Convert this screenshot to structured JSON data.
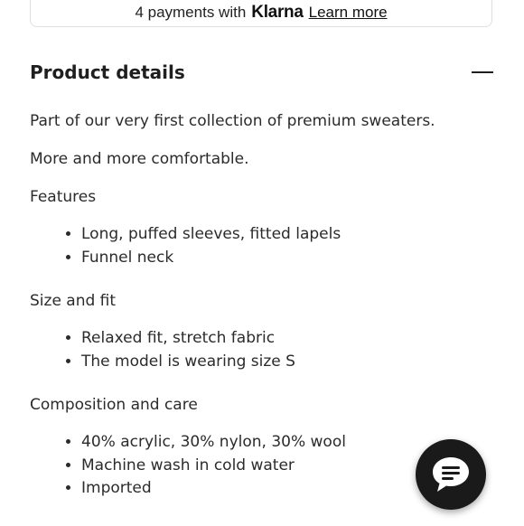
{
  "payments": {
    "prefix": "4 payments with",
    "brand": "Klarna",
    "link": "Learn more"
  },
  "details": {
    "title": "Product details",
    "collapse_icon": "minus-icon",
    "intro": "Part of our very first collection of premium sweaters.",
    "tagline": "More and more comfortable.",
    "sections": [
      {
        "title": "Features",
        "items": [
          "Long, puffed sleeves, fitted lapels",
          "Funnel neck"
        ]
      },
      {
        "title": "Size and fit",
        "items": [
          "Relaxed fit, stretch fabric",
          "The model is wearing size S"
        ]
      },
      {
        "title": "Composition and care",
        "items": [
          "40% acrylic, 30% nylon, 30% wool",
          "Machine wash in cold water",
          "Imported"
        ]
      }
    ]
  },
  "chat": {
    "icon": "chat-bubble-icon",
    "color": "#1a1a1a"
  }
}
